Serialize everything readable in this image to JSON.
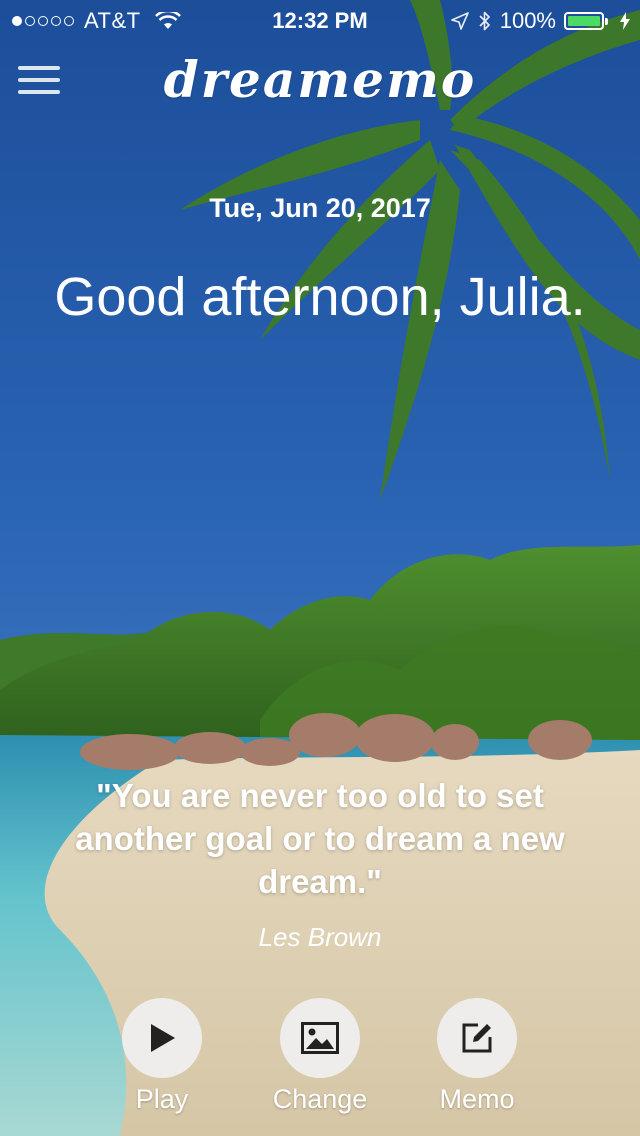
{
  "status_bar": {
    "signal_filled": 1,
    "signal_total": 5,
    "carrier": "AT&T",
    "time": "12:32 PM",
    "battery_text": "100%",
    "battery_level": 1.0,
    "battery_color": "#4cd964",
    "icons": [
      "wifi-icon",
      "location-arrow-icon",
      "bluetooth-icon",
      "battery-icon",
      "charging-bolt-icon"
    ]
  },
  "header": {
    "menu_icon": "hamburger-menu-icon",
    "logo": "dreamemo"
  },
  "main": {
    "date": "Tue, Jun 20, 2017",
    "greeting": "Good afternoon, Julia.",
    "quote": "\"You are never too old to set another goal or to dream a new dream.\"",
    "author": "Les Brown"
  },
  "actions": [
    {
      "label": "Play",
      "icon": "play-icon"
    },
    {
      "label": "Change",
      "icon": "image-icon"
    },
    {
      "label": "Memo",
      "icon": "edit-icon"
    }
  ],
  "colors": {
    "sky_top": "#1f57a6",
    "sky_bottom": "#4d82c6",
    "palm": "#3f7a25",
    "sea": "#5cc0cf",
    "sand": "#e7ddc6",
    "button_bg": "#f0f0f0",
    "icon": "#222222"
  }
}
